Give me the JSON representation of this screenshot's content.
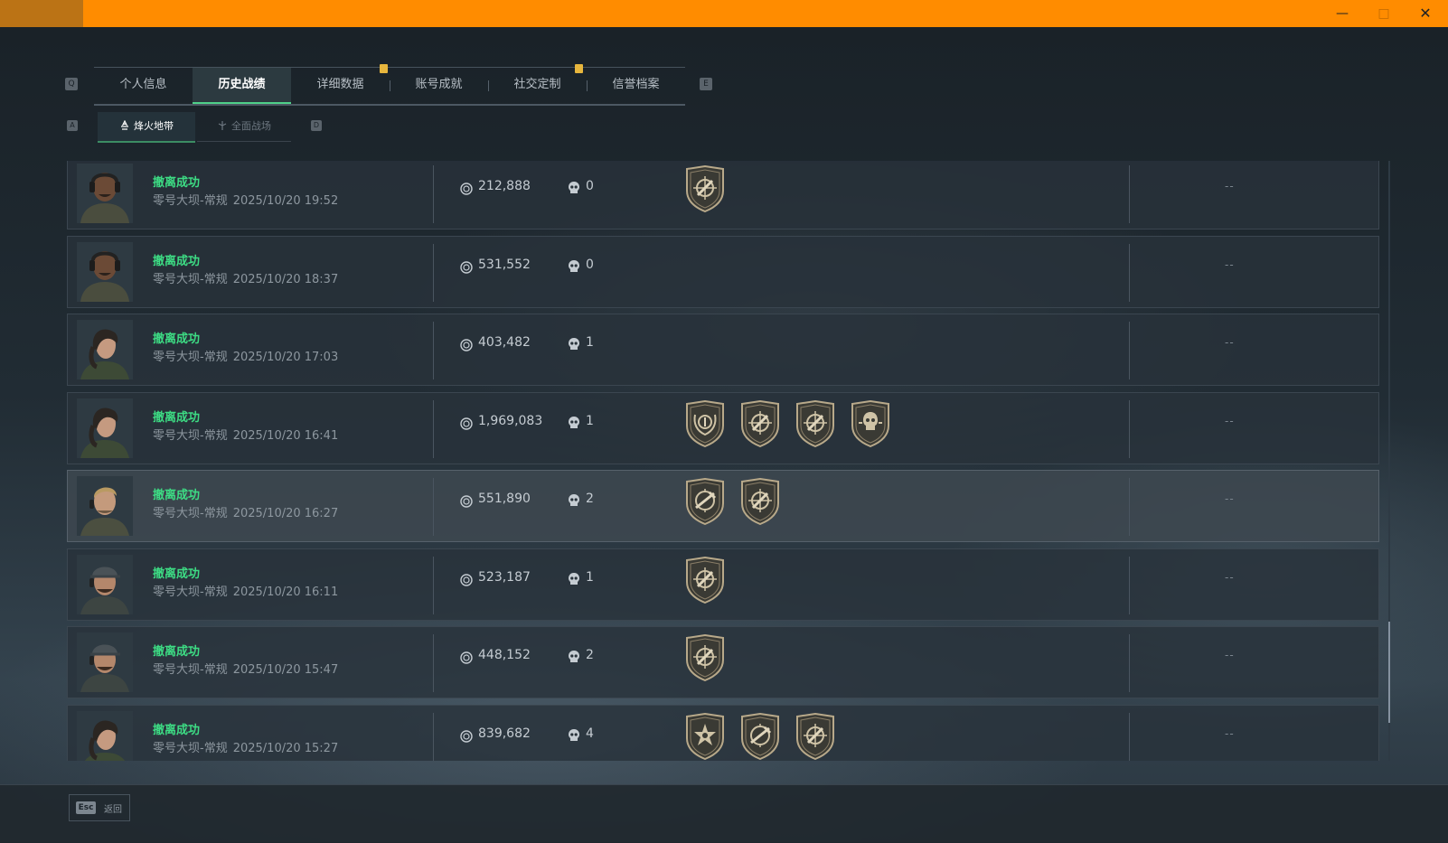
{
  "window": {
    "minimize": "—",
    "maximize": "□",
    "close": "✕"
  },
  "tabs": {
    "left_key": "Q",
    "right_key": "E",
    "items": [
      {
        "label": "个人信息"
      },
      {
        "label": "历史战绩"
      },
      {
        "label": "详细数据"
      },
      {
        "label": "账号成就"
      },
      {
        "label": "社交定制"
      },
      {
        "label": "信誉档案"
      }
    ],
    "active_index": 1
  },
  "subtabs": {
    "left_key": "A",
    "right_key": "D",
    "items": [
      {
        "label": "烽火地带"
      },
      {
        "label": "全面战场"
      }
    ]
  },
  "matches": [
    {
      "status": "撤离成功",
      "map": "零号大坝-常规",
      "datetime": "2025/10/20 19:52",
      "value": "212,888",
      "kills": "0",
      "badges": [
        "crosshair-badge-icon"
      ],
      "extra": "--"
    },
    {
      "status": "撤离成功",
      "map": "零号大坝-常规",
      "datetime": "2025/10/20 18:37",
      "value": "531,552",
      "kills": "0",
      "badges": [],
      "extra": "--"
    },
    {
      "status": "撤离成功",
      "map": "零号大坝-常规",
      "datetime": "2025/10/20 17:03",
      "value": "403,482",
      "kills": "1",
      "badges": [],
      "extra": "--"
    },
    {
      "status": "撤离成功",
      "map": "零号大坝-常规",
      "datetime": "2025/10/20 16:41",
      "value": "1,969,083",
      "kills": "1",
      "badges": [
        "laurel-badge-icon",
        "crosshair-badge-icon",
        "crosshair-badge-icon",
        "skull-badge-icon"
      ],
      "extra": "--"
    },
    {
      "status": "撤离成功",
      "map": "零号大坝-常规",
      "datetime": "2025/10/20 16:27",
      "value": "551,890",
      "kills": "2",
      "badges": [
        "rifle-badge-icon",
        "crosshair-badge-icon"
      ],
      "extra": "--"
    },
    {
      "status": "撤离成功",
      "map": "零号大坝-常规",
      "datetime": "2025/10/20 16:11",
      "value": "523,187",
      "kills": "1",
      "badges": [
        "crosshair-badge-icon"
      ],
      "extra": "--"
    },
    {
      "status": "撤离成功",
      "map": "零号大坝-常规",
      "datetime": "2025/10/20 15:47",
      "value": "448,152",
      "kills": "2",
      "badges": [
        "crosshair-badge-icon"
      ],
      "extra": "--"
    },
    {
      "status": "撤离成功",
      "map": "零号大坝-常规",
      "datetime": "2025/10/20 15:27",
      "value": "839,682",
      "kills": "4",
      "badges": [
        "star-badge-icon",
        "rifle-badge-icon",
        "crosshair-badge-icon"
      ],
      "extra": "--"
    }
  ],
  "avatars": [
    "operator-bald-avatar",
    "operator-bald-avatar",
    "operator-female-avatar",
    "operator-female-avatar",
    "operator-blond-avatar",
    "operator-cap-avatar",
    "operator-cap-avatar",
    "operator-female-avatar"
  ],
  "footer": {
    "esc_key": "Esc",
    "back_label": "返回"
  },
  "colors": {
    "accent": "#ff8c00",
    "success": "#3ddc84",
    "tab_active_line": "#4fd089",
    "badge_gold": "#b8a98a"
  }
}
